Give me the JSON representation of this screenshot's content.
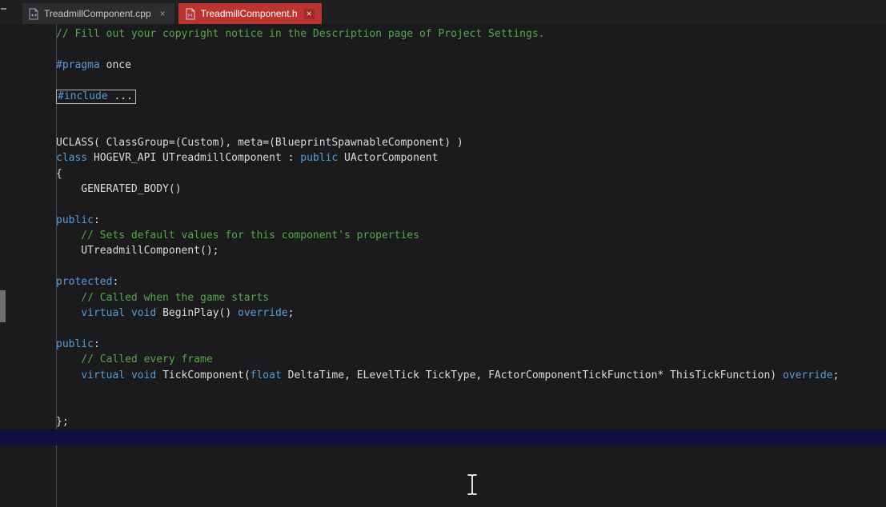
{
  "colors": {
    "keyword": "#569cd6",
    "comment": "#57a64a",
    "plain": "#dcdcdc",
    "active_tab": "#bb3430",
    "editor_bg": "#1b1b1d",
    "caret_line_bg": "#10103e"
  },
  "tabs": [
    {
      "label": "TreadmillComponent.cpp",
      "close": "×",
      "active": false
    },
    {
      "label": "TreadmillComponent.h",
      "close": "×",
      "active": true
    }
  ],
  "editor": {
    "lines": [
      {
        "segs": [
          [
            "c",
            "// Fill out your copyright notice in the Description page of Project Settings."
          ]
        ]
      },
      {
        "segs": []
      },
      {
        "segs": [
          [
            "k",
            "#pragma"
          ],
          [
            "p",
            " once"
          ]
        ]
      },
      {
        "segs": []
      },
      {
        "boxed": true,
        "segs": [
          [
            "k",
            "#include"
          ],
          [
            "p",
            " ..."
          ]
        ]
      },
      {
        "segs": []
      },
      {
        "segs": []
      },
      {
        "segs": [
          [
            "p",
            "UCLASS( ClassGroup=(Custom), meta=(BlueprintSpawnableComponent) )"
          ]
        ]
      },
      {
        "segs": [
          [
            "k",
            "class"
          ],
          [
            "p",
            " HOGEVR_API UTreadmillComponent : "
          ],
          [
            "k",
            "public"
          ],
          [
            "p",
            " UActorComponent"
          ]
        ]
      },
      {
        "segs": [
          [
            "p",
            "{"
          ]
        ]
      },
      {
        "segs": [
          [
            "p",
            "    GENERATED_BODY()"
          ]
        ]
      },
      {
        "segs": []
      },
      {
        "segs": [
          [
            "k",
            "public"
          ],
          [
            "p",
            ":"
          ]
        ]
      },
      {
        "segs": [
          [
            "c",
            "    // Sets default values for this component's properties"
          ]
        ]
      },
      {
        "segs": [
          [
            "p",
            "    UTreadmillComponent();"
          ]
        ]
      },
      {
        "segs": []
      },
      {
        "segs": [
          [
            "k",
            "protected"
          ],
          [
            "p",
            ":"
          ]
        ]
      },
      {
        "segs": [
          [
            "c",
            "    // Called when the game starts"
          ]
        ]
      },
      {
        "segs": [
          [
            "p",
            "    "
          ],
          [
            "k",
            "virtual"
          ],
          [
            "p",
            " "
          ],
          [
            "k",
            "void"
          ],
          [
            "p",
            " BeginPlay() "
          ],
          [
            "k",
            "override"
          ],
          [
            "p",
            ";"
          ]
        ]
      },
      {
        "segs": []
      },
      {
        "segs": [
          [
            "k",
            "public"
          ],
          [
            "p",
            ":"
          ]
        ]
      },
      {
        "segs": [
          [
            "c",
            "    // Called every frame"
          ]
        ]
      },
      {
        "segs": [
          [
            "p",
            "    "
          ],
          [
            "k",
            "virtual"
          ],
          [
            "p",
            " "
          ],
          [
            "k",
            "void"
          ],
          [
            "p",
            " TickComponent("
          ],
          [
            "k",
            "float"
          ],
          [
            "p",
            " DeltaTime, ELevelTick TickType, FActorComponentTickFunction* ThisTickFunction) "
          ],
          [
            "k",
            "override"
          ],
          [
            "p",
            ";"
          ]
        ]
      },
      {
        "segs": []
      },
      {
        "segs": []
      },
      {
        "segs": [
          [
            "p",
            "};"
          ]
        ]
      },
      {
        "caret": true,
        "segs": []
      }
    ]
  }
}
